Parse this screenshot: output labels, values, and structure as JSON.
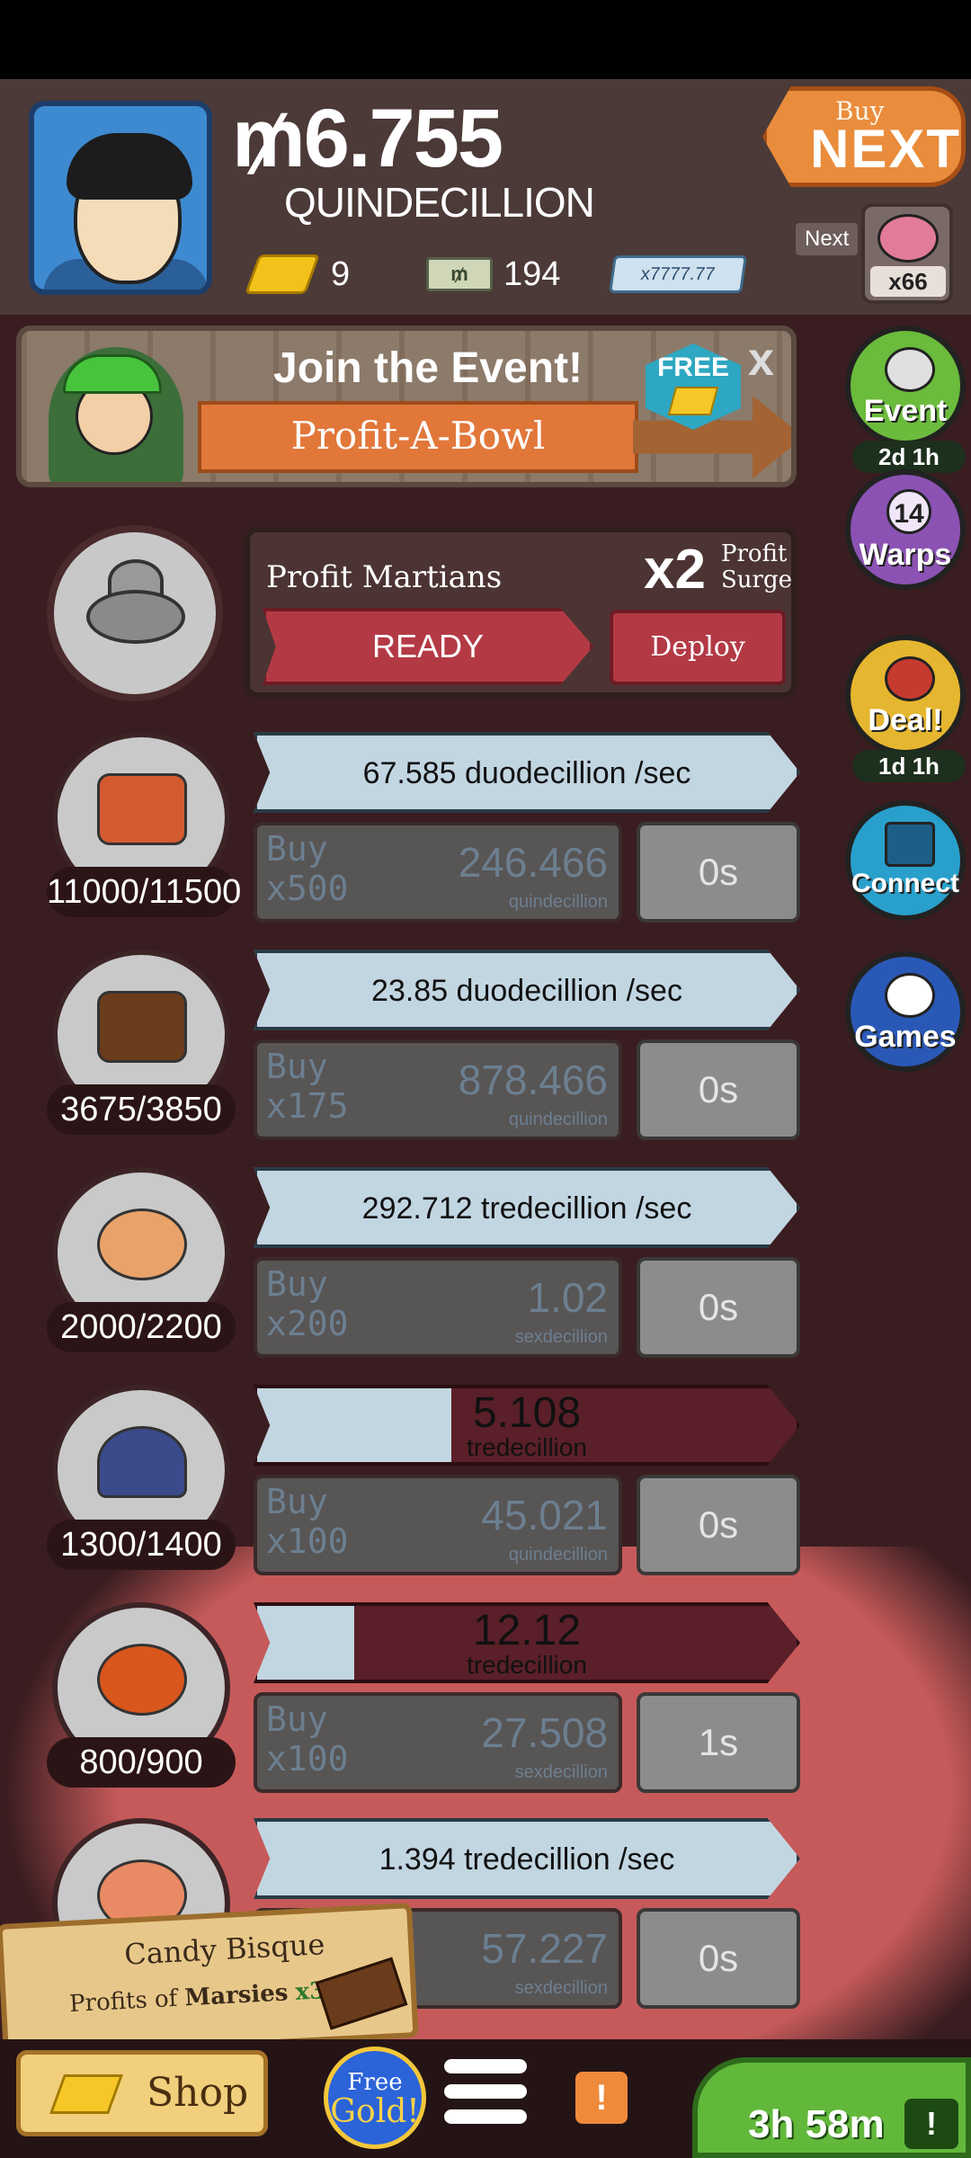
{
  "header": {
    "money_value": "₥6.755",
    "money_unit": "QUINDECILLION",
    "gold_count": "9",
    "megabucks_symbol": "₥",
    "megabucks_count": "194",
    "multiplier_label": "x7777.77",
    "buy_next_small": "Buy",
    "buy_next_big": "NEXT",
    "next_label": "Next",
    "next_item_count": "x66"
  },
  "event_banner": {
    "title": "Join the Event!",
    "event_name": "Profit-A-Bowl",
    "free_label": "FREE",
    "close": "x"
  },
  "side_buttons": [
    {
      "label": "Event",
      "timer": "2d 1h"
    },
    {
      "label": "Warps",
      "count": "14"
    },
    {
      "label": "Deal!",
      "timer": "1d 1h"
    },
    {
      "label": "Connect"
    },
    {
      "label": "Games"
    }
  ],
  "martians": {
    "title": "Profit Martians",
    "multiplier": "x2",
    "multiplier_label_1": "Profit",
    "multiplier_label_2": "Surge",
    "ready_label": "READY",
    "deploy_label": "Deploy"
  },
  "businesses": [
    {
      "count": "11000/11500",
      "rate": "67.585 duodecillion /sec",
      "buy_line1": "Buy",
      "buy_line2": "x500",
      "price": "246.466",
      "price_unit": "quindecillion",
      "timer": "0s",
      "art_color": "#d45a30"
    },
    {
      "count": "3675/3850",
      "rate": "23.85 duodecillion /sec",
      "buy_line1": "Buy",
      "buy_line2": "x175",
      "price": "878.466",
      "price_unit": "quindecillion",
      "timer": "0s",
      "art_color": "#6b3c1c"
    },
    {
      "count": "2000/2200",
      "rate": "292.712 tredecillion /sec",
      "buy_line1": "Buy",
      "buy_line2": "x200",
      "price": "1.02",
      "price_unit": "sexdecillion",
      "timer": "0s",
      "art_color": "#e9a36a"
    },
    {
      "count": "1300/1400",
      "value": "5.108",
      "unit": "tredecillion",
      "progress": 0.36,
      "buy_line1": "Buy",
      "buy_line2": "x100",
      "price": "45.021",
      "price_unit": "quindecillion",
      "timer": "0s",
      "art_color": "#3a4a8a"
    },
    {
      "count": "800/900",
      "value": "12.12",
      "unit": "tredecillion",
      "progress": 0.18,
      "buy_line1": "Buy",
      "buy_line2": "x100",
      "price": "27.508",
      "price_unit": "sexdecillion",
      "timer": "1s",
      "art_color": "#d9561c"
    },
    {
      "count": "",
      "rate": "1.394 tredecillion /sec",
      "buy_line1": "",
      "buy_line2": "",
      "price": "57.227",
      "price_unit": "sexdecillion",
      "timer": "0s",
      "art_color": "#e98a64"
    }
  ],
  "upgrade_toast": {
    "name": "Candy Bisque",
    "desc_prefix": "Profits of",
    "target": "Marsies",
    "mult": "x3.33"
  },
  "bottom_bar": {
    "shop_label": "Shop",
    "gold_btn_line1": "Free",
    "gold_btn_line2": "Gold!",
    "alert": "!",
    "timer": "3h 58m",
    "tv_icon": "!"
  }
}
